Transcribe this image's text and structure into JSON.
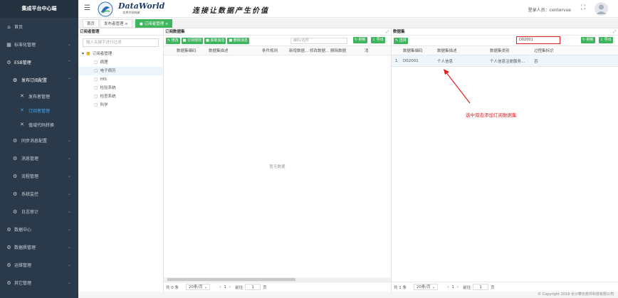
{
  "sidebar": {
    "title": "集成平台中心端",
    "items": [
      {
        "label": "首页",
        "icon": "home-icon"
      },
      {
        "label": "标准化管理",
        "icon": "grid-icon"
      },
      {
        "label": "ESB管理",
        "icon": "gear-icon"
      },
      {
        "label": "发布订阅配置",
        "icon": "gear-icon"
      },
      {
        "label": "发布者管理",
        "icon": "tools-icon"
      },
      {
        "label": "订阅者管理",
        "icon": "tools-icon"
      },
      {
        "label": "值域代码转换",
        "icon": "tools-icon"
      },
      {
        "label": "同步消息配置",
        "icon": "gear-icon"
      },
      {
        "label": "消息管理",
        "icon": "gear-icon"
      },
      {
        "label": "流程管理",
        "icon": "gear-icon"
      },
      {
        "label": "系统监控",
        "icon": "gear-icon"
      },
      {
        "label": "日志审计",
        "icon": "gear-icon"
      },
      {
        "label": "数据中心",
        "icon": "gear-icon"
      },
      {
        "label": "数据质管理",
        "icon": "gear-icon"
      },
      {
        "label": "运维管理",
        "icon": "gear-icon"
      },
      {
        "label": "其它管理",
        "icon": "gear-icon"
      }
    ]
  },
  "header": {
    "brand": "DataWorld",
    "brand_sub": "北京方位科技",
    "slogan": "连接让数据产生价值",
    "login_text": "登录人员：centervue"
  },
  "tabs": {
    "home": "首页",
    "publisher": "发布者管理",
    "subscriber": "订阅者管理"
  },
  "tree_panel": {
    "title": "订阅者管理",
    "search_placeholder": "输入关键字进行过滤",
    "root": "订阅者管理",
    "nodes": [
      "病理",
      "电子病历",
      "HIS",
      "检验系统",
      "检查系统",
      "科学"
    ]
  },
  "subscribe_panel": {
    "title": "订阅数据集",
    "buttons": {
      "edit": "修改",
      "rules": "订阅规则",
      "fetch": "获取消息",
      "delete": "删除消息",
      "refresh": "刷新",
      "export": "导出"
    },
    "search_placeholder": "编码/名称",
    "columns": [
      "数据集编码",
      "数据集描述",
      "条件规则",
      "新增数据...",
      "修改数据...",
      "删除数据",
      "消"
    ],
    "empty": "暂无数据",
    "total": "共 0 条",
    "page_size": "20条/页",
    "goto": "前往",
    "page": "1",
    "page_unit": "页"
  },
  "dataset_panel": {
    "title": "数据集",
    "buttons": {
      "select": "选择",
      "refresh": "刷新",
      "export": "导出"
    },
    "search_value": "D02001",
    "columns": [
      "数据集编码",
      "数据集描述",
      "数据集类别",
      "过程集标识"
    ],
    "rows": [
      {
        "index": "1",
        "code": "D02001",
        "desc": "个人信息",
        "category": "个人信息注册服务...",
        "flag": "否"
      }
    ],
    "total": "共 1 条",
    "page_size": "20条/页",
    "goto": "前往",
    "page": "1",
    "page_unit": "页"
  },
  "annotation": "选中双击添加订阅数据集",
  "footer": "© Copyright 2016 长沙攀氏软件科技有限公司",
  "colors": {
    "sidebar_bg": "#2b3a4a",
    "accent_green": "#3fb55d",
    "active_blue": "#3ea8f5",
    "annotation_red": "#e02020"
  }
}
